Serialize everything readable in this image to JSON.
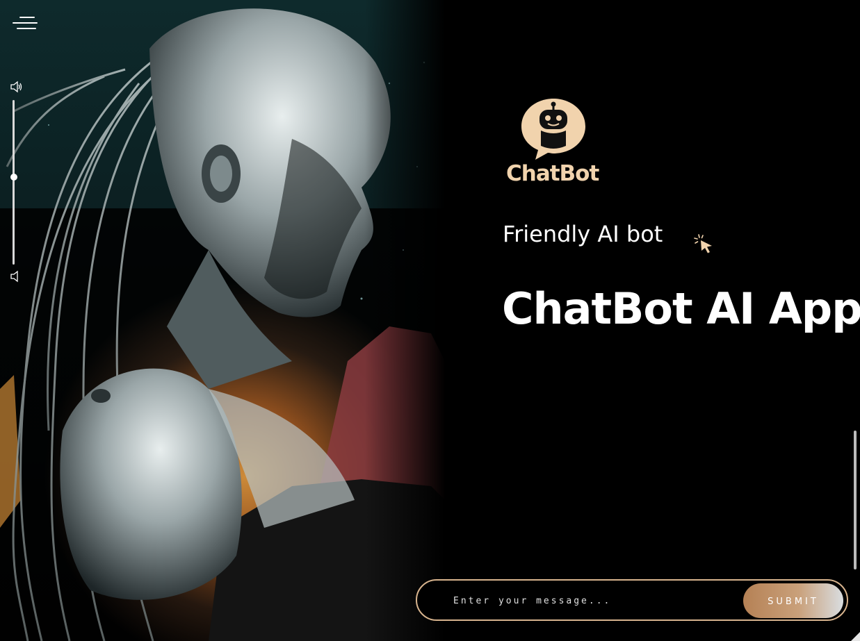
{
  "app": {
    "brand_name": "ChatBot",
    "tagline": "Friendly AI bot",
    "headline": "ChatBot AI App"
  },
  "chat_form": {
    "placeholder": "Enter your message...",
    "value": "",
    "submit_label": "SUBMIT"
  },
  "volume": {
    "level": 0.53
  },
  "colors": {
    "background": "#000000",
    "accent": "#f1d3ad",
    "form_border": "#d8b48e",
    "button_gradient_start": "#b58155",
    "button_gradient_end": "#d9dde0"
  },
  "icons": {
    "menu": "hamburger-menu-icon",
    "volume_up": "speaker-loud-icon",
    "volume_down": "speaker-quiet-icon",
    "logo": "robot-chat-bubble-icon",
    "cursor": "click-cursor-icon"
  }
}
